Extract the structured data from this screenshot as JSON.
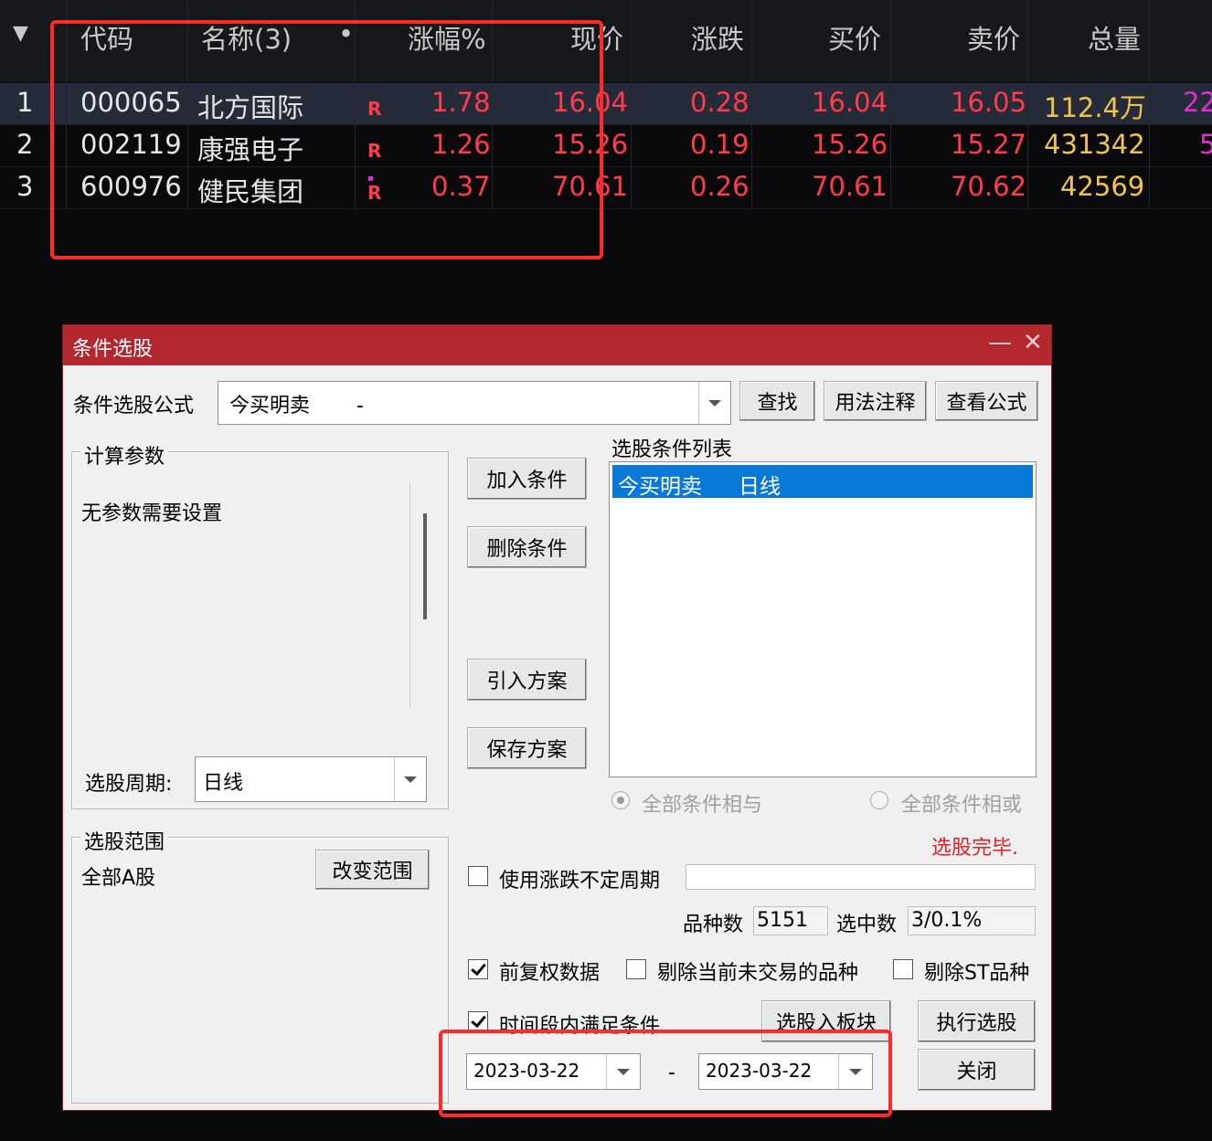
{
  "table": {
    "headers": {
      "menu": "▼",
      "code": "代码",
      "name": "名称(3)",
      "dot": "•",
      "change_pct": "涨幅%",
      "price": "现价",
      "change": "涨跌",
      "bid": "买价",
      "ask": "卖价",
      "volume": "总量"
    },
    "rows": [
      {
        "idx": "1",
        "code": "000065",
        "name": "北方国际",
        "flag": "R",
        "change_pct": "1.78",
        "price": "16.04",
        "change": "0.28",
        "bid": "16.04",
        "ask": "16.05",
        "volume": "112.4万",
        "extra": "22"
      },
      {
        "idx": "2",
        "code": "002119",
        "name": "康强电子",
        "flag": "R",
        "change_pct": "1.26",
        "price": "15.26",
        "change": "0.19",
        "bid": "15.26",
        "ask": "15.27",
        "volume": "431342",
        "extra": "5"
      },
      {
        "idx": "3",
        "code": "600976",
        "name": "健民集团",
        "flag": "R",
        "change_pct": "0.37",
        "price": "70.61",
        "change": "0.26",
        "bid": "70.61",
        "ask": "70.62",
        "volume": "42569",
        "extra": ""
      }
    ]
  },
  "dialog": {
    "title": "条件选股",
    "minimize": "—",
    "close": "✕",
    "formula_label": "条件选股公式",
    "formula_value": "今买明卖　　 -",
    "find_button": "查找",
    "usage_button": "用法注释",
    "view_formula_button": "查看公式",
    "params_group": "计算参数",
    "params_text": "无参数需要设置",
    "period_label": "选股周期:",
    "period_value": "日线",
    "scope_group": "选股范围",
    "scope_value": "全部A股",
    "change_scope_button": "改变范围",
    "add_condition_button": "加入条件",
    "delete_condition_button": "删除条件",
    "import_plan_button": "引入方案",
    "save_plan_button": "保存方案",
    "condition_list_label": "选股条件列表",
    "condition_list": [
      {
        "name": "今买明卖",
        "period": "日线"
      }
    ],
    "radio_and": "全部条件相与",
    "radio_or": "全部条件相或",
    "status": "选股完毕.",
    "uncertain_period_label": "使用涨跌不定周期",
    "uncertain_period_value": "",
    "count_label": "品种数",
    "count_value": "5151",
    "selected_label": "选中数",
    "selected_value": "3/0.1%",
    "forward_adjust_label": "前复权数据",
    "exclude_untraded_label": "剔除当前未交易的品种",
    "exclude_st_label": "剔除ST品种",
    "time_range_label": "时间段内满足条件",
    "to_block_button": "选股入板块",
    "execute_button": "执行选股",
    "close_button": "关闭",
    "date_from": "2023-03-22",
    "date_separator": "-",
    "date_to": "2023-03-22"
  },
  "colors": {
    "up_red": "#ff3b4c",
    "volume_yellow": "#f0c34a",
    "title_bar": "#b3282f",
    "selection_blue": "#0a78d7",
    "highlight_box": "#ff2a2a"
  }
}
